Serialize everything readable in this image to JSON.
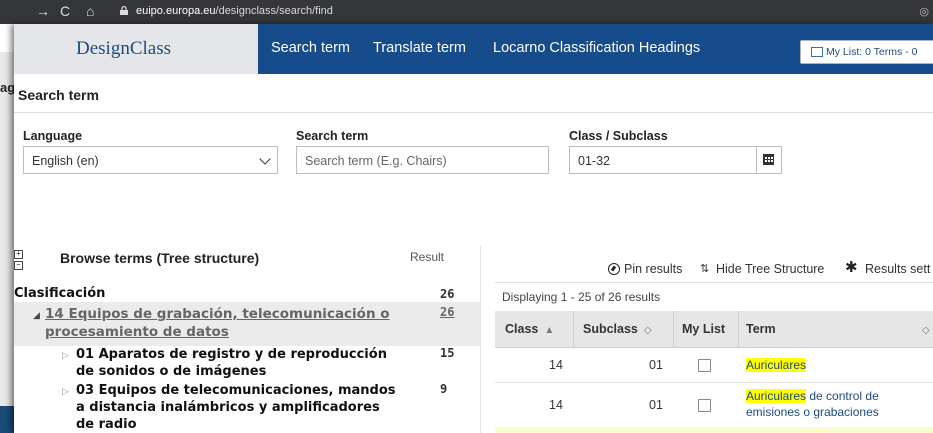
{
  "browser": {
    "url_domain": "euipo.europa.eu",
    "url_path": "/designclass/search/find"
  },
  "background": {
    "fragment_label": "ag"
  },
  "header": {
    "brand": "DesignClass",
    "nav": [
      "Search term",
      "Translate term",
      "Locarno Classification Headings"
    ],
    "my_list": "My List: 0 Terms - 0"
  },
  "section_title": "Search term",
  "form": {
    "language_label": "Language",
    "language_value": "English (en)",
    "search_label": "Search term",
    "search_placeholder": "Search term (E.g. Chairs)",
    "class_label": "Class / Subclass",
    "class_value": "01-32"
  },
  "tree": {
    "title": "Browse terms (Tree structure)",
    "result_label": "Result",
    "root": {
      "label": "Clasificación",
      "count": "26"
    },
    "level1": {
      "label": "14 Equipos de grabación, telecomunicación o procesamiento de datos",
      "count": "26"
    },
    "children": [
      {
        "label": "01 Aparatos de registro y de reproducción de sonidos o de imágenes",
        "count": "15"
      },
      {
        "label": "03 Equipos de telecomunicaciones, mandos a distancia inalámbricos y amplificadores de radio",
        "count": "9"
      }
    ]
  },
  "results": {
    "toolbar": {
      "pin": "Pin results",
      "hide_tree": "Hide Tree Structure",
      "settings": "Results sett"
    },
    "displaying": "Displaying 1 - 25 of 26 results",
    "columns": {
      "class": "Class",
      "subclass": "Subclass",
      "mylist": "My List",
      "term": "Term"
    },
    "rows": [
      {
        "class": "14",
        "subclass": "01",
        "term_highlight": "Auriculares",
        "term_rest": ""
      },
      {
        "class": "14",
        "subclass": "01",
        "term_highlight": "Auriculares",
        "term_rest": " de control de emisiones o grabaciones"
      }
    ]
  },
  "colors": {
    "nav_bg": "#164b8c",
    "brand_text": "#1e4a7f",
    "highlight": "#ffff00"
  }
}
